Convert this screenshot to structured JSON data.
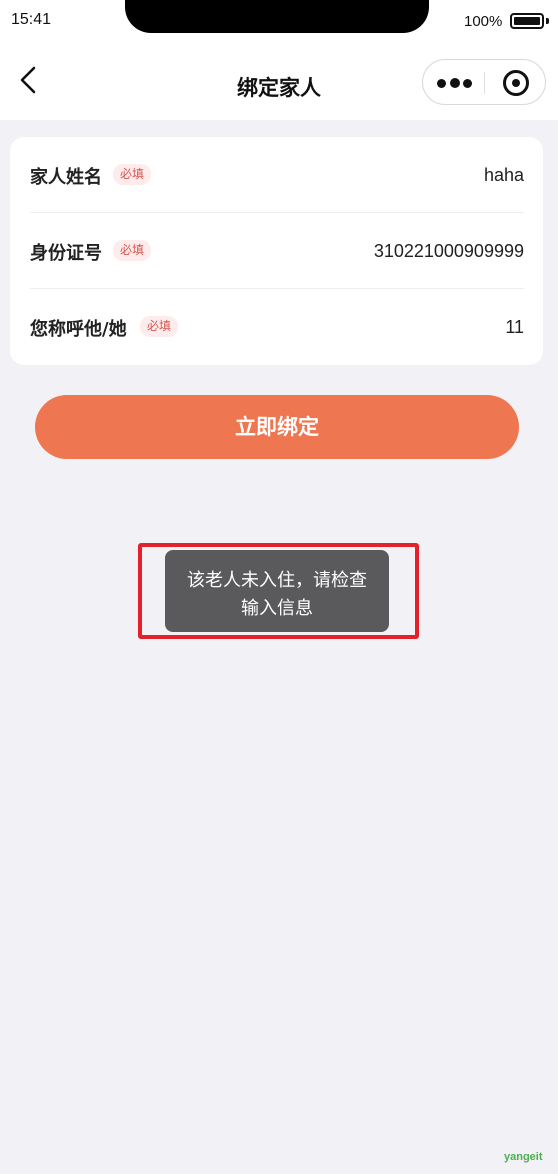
{
  "status_bar": {
    "time": "15:41",
    "battery_label": "100%",
    "battery_level": 1.0
  },
  "nav": {
    "title": "绑定家人",
    "back_icon": "chevron-left-icon",
    "more_icon": "more-dots-icon",
    "close_icon": "target-close-icon"
  },
  "form": {
    "rows": [
      {
        "label": "家人姓名",
        "tag": "必填",
        "value": "haha"
      },
      {
        "label": "身份证号",
        "tag": "必填",
        "value": "310221000909999"
      },
      {
        "label": "您称呼他/她",
        "tag": "必填",
        "value": "11"
      }
    ]
  },
  "bind_button": {
    "label": "立即绑定"
  },
  "toast": {
    "message": "该老人未入住，请检查输入信息"
  },
  "watermark": "yangeit",
  "colors": {
    "accent": "#ee7650",
    "required_tag": "#d9534f",
    "toast_bg": "#5a5a5c",
    "highlight": "#e5202a",
    "page_bg": "#f2f1f6"
  }
}
